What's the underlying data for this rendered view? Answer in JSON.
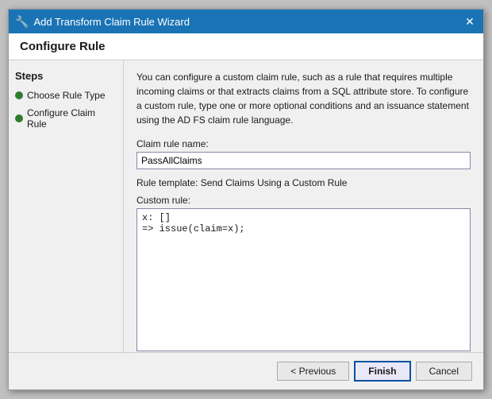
{
  "window": {
    "title": "Add Transform Claim Rule Wizard",
    "close_label": "✕"
  },
  "header": {
    "title": "Configure Rule"
  },
  "sidebar": {
    "section_title": "Steps",
    "items": [
      {
        "label": "Choose Rule Type"
      },
      {
        "label": "Configure Claim Rule"
      }
    ]
  },
  "main": {
    "description": "You can configure a custom claim rule, such as a rule that requires multiple incoming claims or that extracts claims from a SQL attribute store. To configure a custom rule, type one or more optional conditions and an issuance statement using the AD FS claim rule language.",
    "claim_rule_name_label": "Claim rule name:",
    "claim_rule_name_value": "PassAllClaims",
    "rule_template_text": "Rule template: Send Claims Using a Custom Rule",
    "custom_rule_label": "Custom rule:",
    "custom_rule_value": "x: []\n=> issue(claim=x);"
  },
  "footer": {
    "previous_label": "< Previous",
    "finish_label": "Finish",
    "cancel_label": "Cancel"
  }
}
